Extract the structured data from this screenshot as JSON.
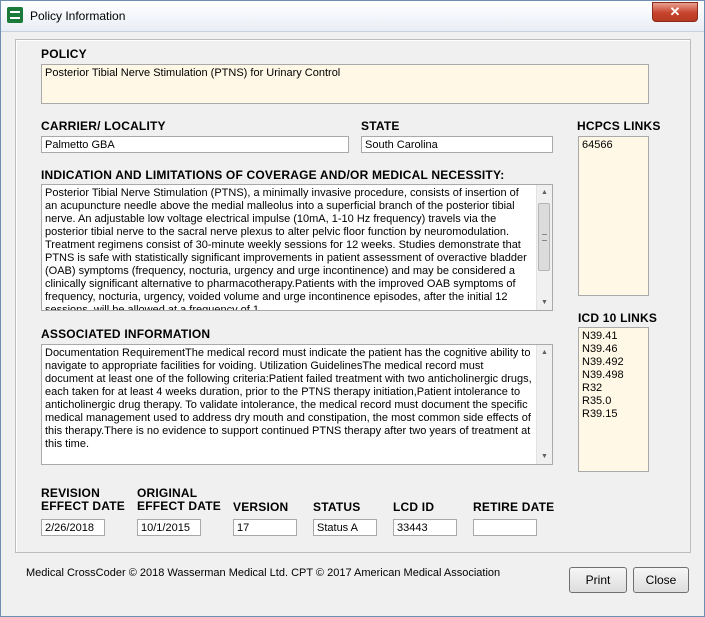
{
  "window": {
    "title": "Policy Information",
    "close_glyph": "✕"
  },
  "policy": {
    "label": "POLICY",
    "value": "Posterior Tibial Nerve Stimulation  (PTNS) for Urinary  Control"
  },
  "carrier": {
    "label": "CARRIER/ LOCALITY",
    "value": "Palmetto GBA"
  },
  "state": {
    "label": "STATE",
    "value": "South Carolina"
  },
  "hcpcs": {
    "label": "HCPCS LINKS",
    "items": [
      "64566"
    ]
  },
  "indication": {
    "label": "INDICATION AND  LIMITATIONS OF COVERAGE AND/OR MEDICAL NECESSITY:",
    "text": "Posterior Tibial Nerve Stimulation (PTNS), a minimally invasive procedure, consists of insertion of an acupuncture needle above the medial malleolus into a superficial branch of the posterior tibial nerve. An adjustable low voltage electrical impulse (10mA, 1-10 Hz frequency) travels via the posterior tibial nerve to the sacral nerve plexus to alter pelvic floor function by neuromodulation. Treatment regimens consist of 30-minute weekly sessions for 12 weeks. Studies demonstrate that PTNS is safe with statistically significant improvements in patient assessment of overactive bladder (OAB) symptoms (frequency, nocturia, urgency and urge incontinence) and may be considered a clinically significant alternative to pharmacotherapy.Patients with the improved OAB symptoms of frequency, nocturia, urgency, voided volume and urge incontinence episodes, after the initial 12 sessions, will be allowed at a frequency of 1"
  },
  "associated": {
    "label": "ASSOCIATED INFORMATION",
    "text": "Documentation RequirementThe medical record must indicate the patient has the cognitive ability to navigate to appropriate facilities for voiding. Utilization GuidelinesThe medical record must document at least one of the following criteria:Patient failed treatment with two anticholinergic drugs, each taken for at least 4 weeks duration, prior to the PTNS therapy initiation,Patient intolerance to anticholinergic drug therapy. To validate intolerance, the medical record must document the specific medical management used to address dry mouth and constipation, the most common side effects of this therapy.There is no evidence to support continued PTNS therapy after two years of treatment at this time."
  },
  "icd10": {
    "label": "ICD 10 LINKS",
    "items": [
      "N39.41",
      "N39.46",
      "N39.492",
      "N39.498",
      "R32",
      "R35.0",
      "R39.15"
    ]
  },
  "revision": {
    "label_line1": "REVISION",
    "label_line2": "EFFECT DATE",
    "value": "2/26/2018"
  },
  "original": {
    "label_line1": "ORIGINAL",
    "label_line2": "EFFECT DATE",
    "value": "10/1/2015"
  },
  "version": {
    "label": "VERSION",
    "value": "17"
  },
  "status": {
    "label": "STATUS",
    "value": "Status A"
  },
  "lcd": {
    "label": "LCD ID",
    "value": "33443"
  },
  "retire": {
    "label": "RETIRE DATE",
    "value": ""
  },
  "footer": {
    "text": "Medical CrossCoder © 2018 Wasserman Medical Ltd.   CPT © 2017 American Medical Association"
  },
  "buttons": {
    "print": "Print",
    "close": "Close"
  },
  "scroll": {
    "up": "▲",
    "down": "▼"
  }
}
